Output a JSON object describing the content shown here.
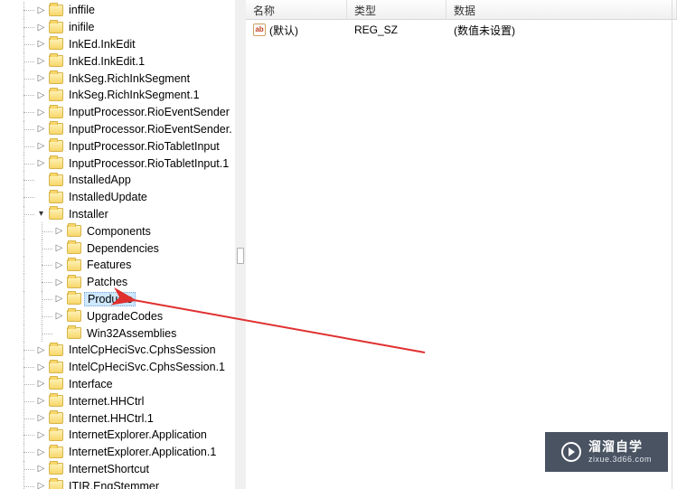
{
  "columns": {
    "name": "名称",
    "type": "类型",
    "data": "数据"
  },
  "row": {
    "name": "(默认)",
    "type": "REG_SZ",
    "data": "(数值未设置)"
  },
  "tree": {
    "level0": [
      {
        "name": "inffile",
        "toggle": "closed"
      },
      {
        "name": "inifile",
        "toggle": "closed"
      },
      {
        "name": "InkEd.InkEdit",
        "toggle": "closed"
      },
      {
        "name": "InkEd.InkEdit.1",
        "toggle": "closed"
      },
      {
        "name": "InkSeg.RichInkSegment",
        "toggle": "closed"
      },
      {
        "name": "InkSeg.RichInkSegment.1",
        "toggle": "closed"
      },
      {
        "name": "InputProcessor.RioEventSender",
        "toggle": "closed"
      },
      {
        "name": "InputProcessor.RioEventSender.",
        "toggle": "closed"
      },
      {
        "name": "InputProcessor.RioTabletInput",
        "toggle": "closed"
      },
      {
        "name": "InputProcessor.RioTabletInput.1",
        "toggle": "closed"
      },
      {
        "name": "InstalledApp",
        "toggle": "none"
      },
      {
        "name": "InstalledUpdate",
        "toggle": "none"
      },
      {
        "name": "Installer",
        "toggle": "open"
      }
    ],
    "installer_children": [
      {
        "name": "Components",
        "toggle": "closed"
      },
      {
        "name": "Dependencies",
        "toggle": "closed"
      },
      {
        "name": "Features",
        "toggle": "closed"
      },
      {
        "name": "Patches",
        "toggle": "closed"
      },
      {
        "name": "Products",
        "toggle": "closed",
        "selected": true
      },
      {
        "name": "UpgradeCodes",
        "toggle": "closed"
      },
      {
        "name": "Win32Assemblies",
        "toggle": "none"
      }
    ],
    "level0_after": [
      {
        "name": "IntelCpHeciSvc.CphsSession",
        "toggle": "closed"
      },
      {
        "name": "IntelCpHeciSvc.CphsSession.1",
        "toggle": "closed"
      },
      {
        "name": "Interface",
        "toggle": "closed"
      },
      {
        "name": "Internet.HHCtrl",
        "toggle": "closed"
      },
      {
        "name": "Internet.HHCtrl.1",
        "toggle": "closed"
      },
      {
        "name": "InternetExplorer.Application",
        "toggle": "closed"
      },
      {
        "name": "InternetExplorer.Application.1",
        "toggle": "closed"
      },
      {
        "name": "InternetShortcut",
        "toggle": "closed"
      },
      {
        "name": "ITIR.EngStemmer",
        "toggle": "closed"
      }
    ]
  },
  "watermark": {
    "top": "溜溜自学",
    "bottom": "zixue.3d66.com"
  }
}
